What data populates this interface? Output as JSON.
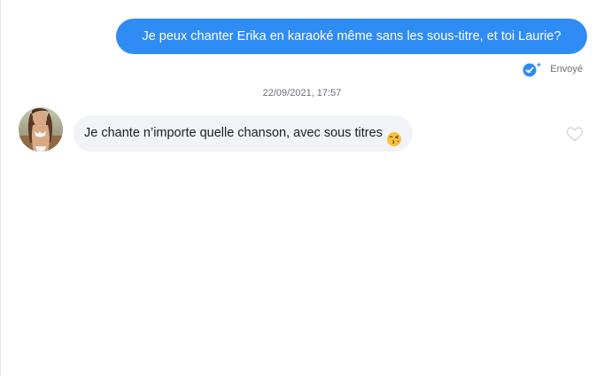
{
  "conversation": {
    "sent_message": {
      "text": "Je peux chanter Erika en karaoké même sans les sous-titre, et toi Laurie?",
      "status": "Envoyé",
      "status_icon": "double-check-sparkle-icon"
    },
    "timestamp": "22/09/2021, 17:57",
    "received_message": {
      "text": "Je chante n’importe quelle chanson, avec sous titres",
      "emoji": "kissing-face-icon",
      "like_icon": "heart-icon"
    }
  },
  "colors": {
    "sent_bubble": "#2f8cf5",
    "received_bubble": "#f2f3f6",
    "meta_text": "#6b6f7a"
  }
}
